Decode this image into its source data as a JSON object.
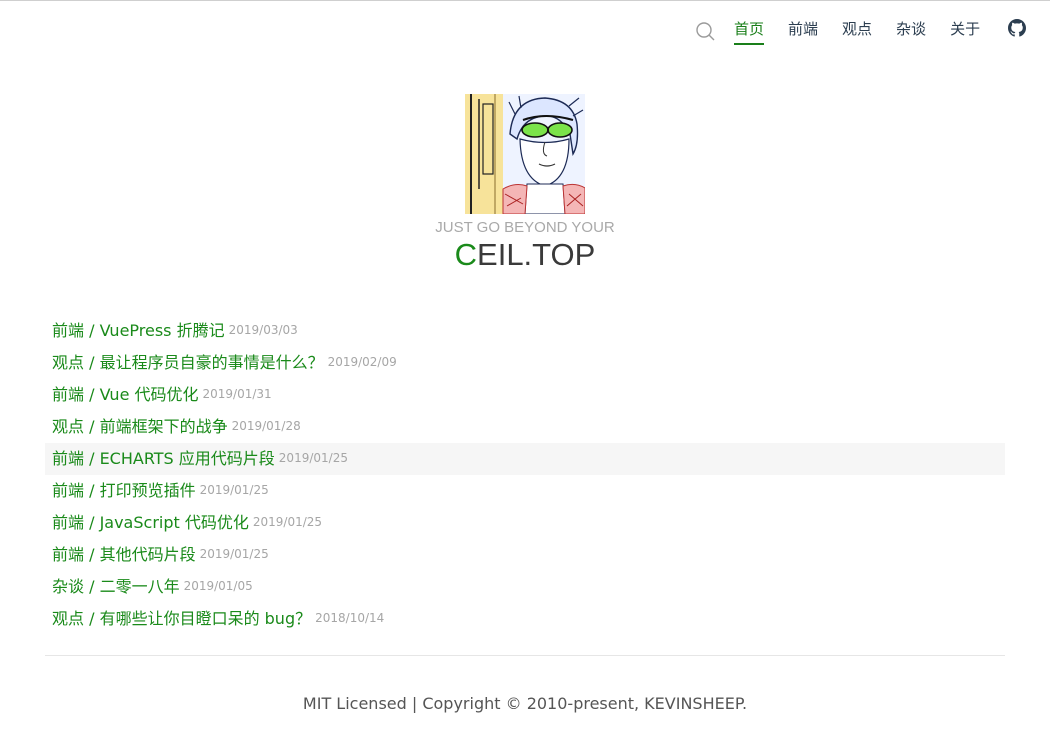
{
  "nav": {
    "links": [
      {
        "label": "首页",
        "active": true
      },
      {
        "label": "前端",
        "active": false
      },
      {
        "label": "观点",
        "active": false
      },
      {
        "label": "杂谈",
        "active": false
      },
      {
        "label": "关于",
        "active": false
      }
    ],
    "search_icon": "search-icon",
    "github_icon": "github-icon"
  },
  "hero": {
    "tagline": "JUST GO BEYOND YOUR",
    "name_first_letter": "C",
    "name_rest": "EIL.TOP",
    "accent_color": "#1a8a1a"
  },
  "posts": [
    {
      "title": "前端 / VuePress 折腾记",
      "date": "2019/03/03"
    },
    {
      "title": "观点 / 最让程序员自豪的事情是什么？",
      "date": "2019/02/09"
    },
    {
      "title": "前端 / Vue 代码优化",
      "date": "2019/01/31"
    },
    {
      "title": "观点 / 前端框架下的战争",
      "date": "2019/01/28"
    },
    {
      "title": "前端 / ECHARTS 应用代码片段",
      "date": "2019/01/25"
    },
    {
      "title": "前端 / 打印预览插件",
      "date": "2019/01/25"
    },
    {
      "title": "前端 / JavaScript 代码优化",
      "date": "2019/01/25"
    },
    {
      "title": "前端 / 其他代码片段",
      "date": "2019/01/25"
    },
    {
      "title": "杂谈 / 二零一八年",
      "date": "2019/01/05"
    },
    {
      "title": "观点 / 有哪些让你目瞪口呆的 bug？",
      "date": "2018/10/14"
    }
  ],
  "footer": {
    "text": "MIT Licensed | Copyright © 2010-present, KEVINSHEEP."
  }
}
